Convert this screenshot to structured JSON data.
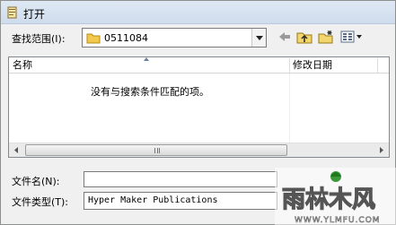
{
  "window": {
    "title": "打开"
  },
  "lookin": {
    "label": "查找范围(I):",
    "value": "0511084"
  },
  "list": {
    "columns": [
      "名称",
      "修改日期"
    ],
    "empty_message": "没有与搜索条件匹配的项。"
  },
  "filename": {
    "label": "文件名(N):",
    "value": ""
  },
  "filetype": {
    "label": "文件类型(T):",
    "value": "Hyper Maker Publications"
  },
  "watermark": {
    "brand": "雨林木风",
    "url": "WWW.YLMFU.COM"
  }
}
